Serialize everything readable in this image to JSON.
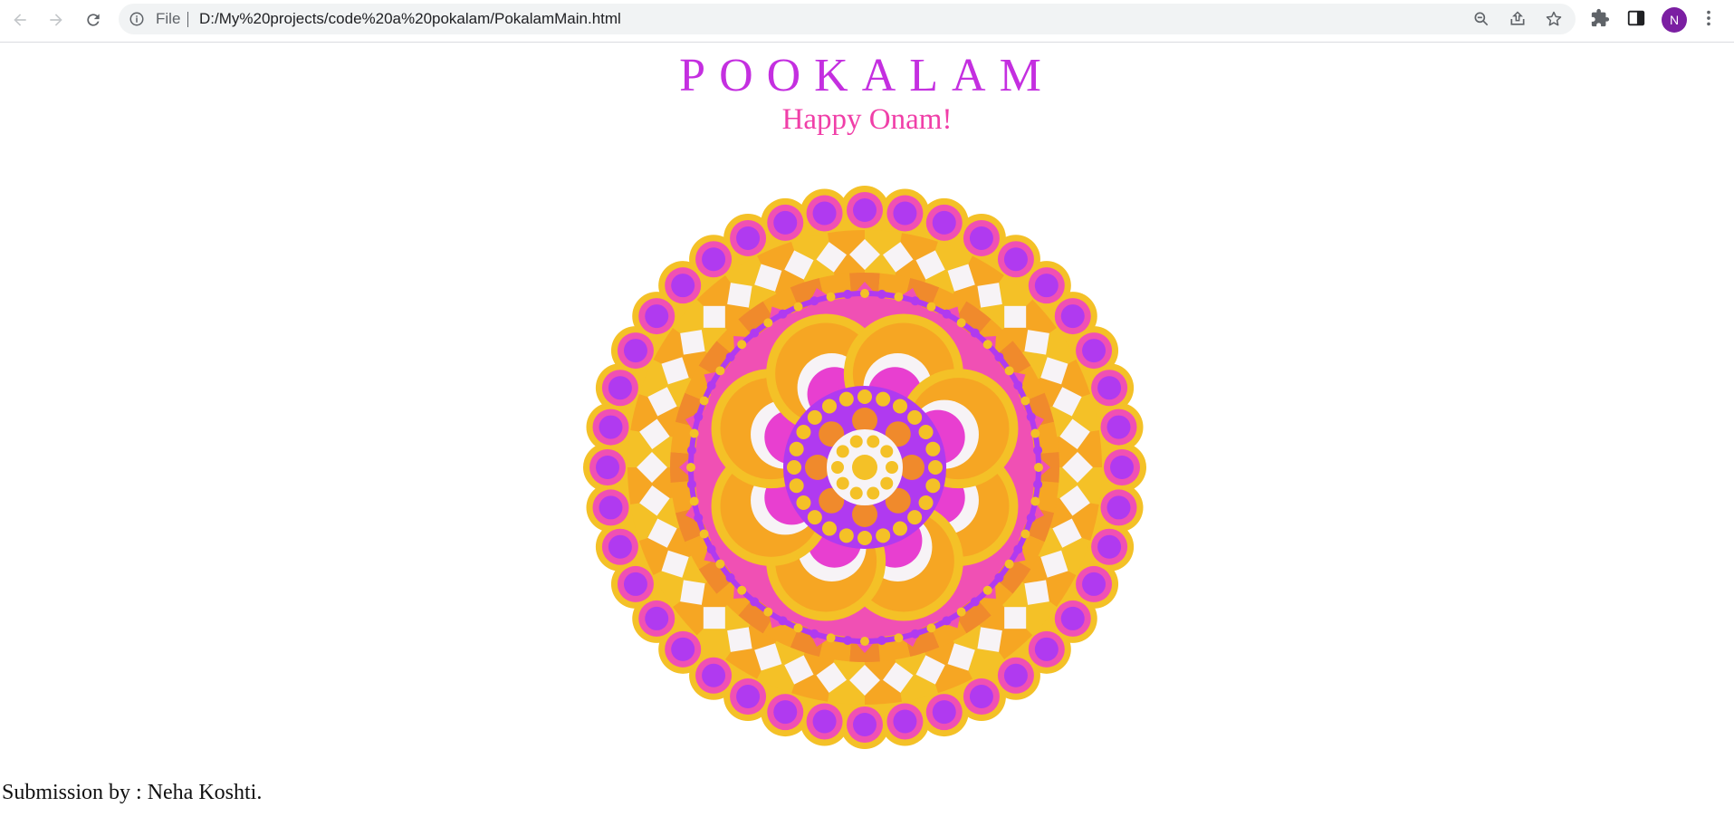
{
  "browser": {
    "address_scheme": "File",
    "address_url": "D:/My%20projects/code%20a%20pokalam/PokalamMain.html",
    "profile_initial": "N",
    "icons": [
      "back-arrow-icon",
      "forward-arrow-icon",
      "reload-icon",
      "info-icon",
      "zoom-out-icon",
      "share-icon",
      "star-icon",
      "extensions-puzzle-icon",
      "side-panel-icon",
      "more-vert-icon"
    ]
  },
  "page": {
    "title": "POOKALAM",
    "subtitle": "Happy Onam!",
    "credit": "Submission by : Neha Koshti."
  },
  "colors": {
    "title": "#c42fe0",
    "subtitle": "#f03fa8",
    "yellow": "#f4c127",
    "orange": "#f6a623",
    "deep_orange": "#f08a2c",
    "pink": "#f050b4",
    "magenta": "#e83fd0",
    "purple": "#b03af0",
    "white": "#f7f3f6"
  }
}
